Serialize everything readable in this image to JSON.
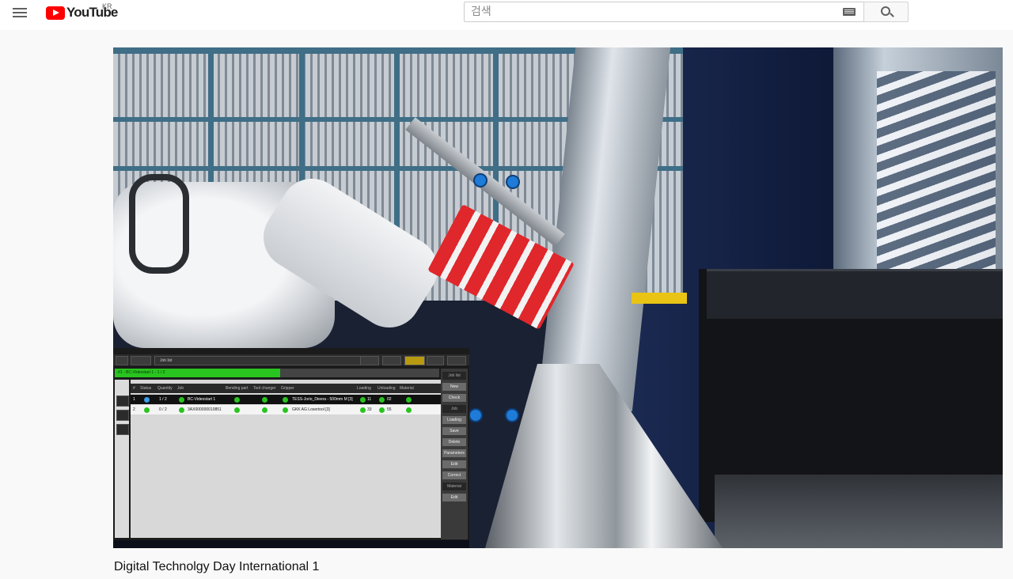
{
  "header": {
    "logo_text": "YouTube",
    "logo_country": "KR",
    "search_placeholder": "검색"
  },
  "icons": [
    "menu-icon",
    "youtube-logo-icon",
    "keyboard-icon",
    "search-icon"
  ],
  "video": {
    "title": "Digital Technolgy Day International 1"
  },
  "embedded_screen": {
    "job_field": "Job list",
    "progress_label": "#1 - BC-Videostart 1 - 1 / 2",
    "progress_fraction": 0.5,
    "columns": [
      "#",
      "Status",
      "Quantity",
      "Job",
      "Bending part",
      "Tool changer",
      "Gripper",
      "Loading",
      "Unloading",
      "Material"
    ],
    "rows": [
      {
        "num": "1",
        "quantity": "1 / 2",
        "job": "BC-Videostart 1",
        "gripper": "TESS-Jorio_Dieera - 500mm M [3]",
        "loading": "11",
        "unloading": "02"
      },
      {
        "num": "2",
        "quantity": "0 / 2",
        "job": "3AX000000010851",
        "gripper": "GKK AG Losertool [3]",
        "loading": "33",
        "unloading": "55"
      }
    ],
    "right_panel": [
      "Job list",
      "New",
      "Check",
      "Job",
      "Loading",
      "Save",
      "Delete",
      "Parameters",
      "Edit",
      "Correct",
      "Material",
      "Edit"
    ]
  }
}
